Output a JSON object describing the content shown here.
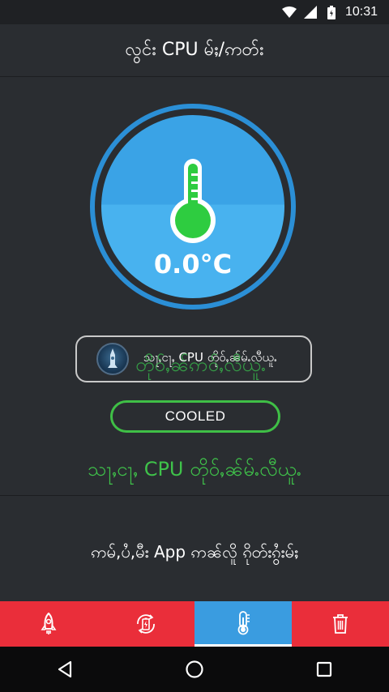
{
  "status_bar": {
    "time": "10:31",
    "icons": [
      "wifi-icon",
      "signal-icon",
      "battery-icon"
    ]
  },
  "header": {
    "title": "လွင်း CPU မ်ႈ/ဢတ်း"
  },
  "gauge": {
    "temperature": "0.0°C",
    "icon": "thermometer-icon",
    "colors": {
      "ring": "#2b8fd6",
      "fill_top": "#3aa3e6",
      "fill_bottom": "#48b2ef",
      "bulb": "#2ecc40"
    }
  },
  "toast": {
    "text": "သႃႇငႃႇ CPU တိုဝ်ႇၼ်မ်ႉလီယူႉ",
    "overlay_text": "တိုဝ်ႇၼ်ဢဝ်ႇလီယူႉ"
  },
  "status_badge": {
    "label": "COOLED",
    "color": "#3fbf46"
  },
  "status_message": {
    "text": "သႃႇငႃႇ CPU တိုဝ်ႇၼ်မ်ႉလီယူႉ",
    "color": "#3fc24a"
  },
  "info": {
    "text": "ဢမ်,ပႆ,မီး App ဢၼ်လိူ ၵိုတ်းၵွႆးမ်ႈ"
  },
  "bottom_tabs": [
    {
      "name": "boost",
      "icon": "rocket-icon",
      "active": false
    },
    {
      "name": "battery",
      "icon": "battery-saver-icon",
      "active": false
    },
    {
      "name": "cpu-cooler",
      "icon": "thermometer-icon",
      "active": true
    },
    {
      "name": "cleaner",
      "icon": "trash-icon",
      "active": false
    }
  ],
  "nav_bar": [
    "back-icon",
    "home-icon",
    "recents-icon"
  ],
  "theme": {
    "background": "#2a2d31",
    "tab_red": "#ea2e3a",
    "tab_blue": "#3a9ce0"
  }
}
